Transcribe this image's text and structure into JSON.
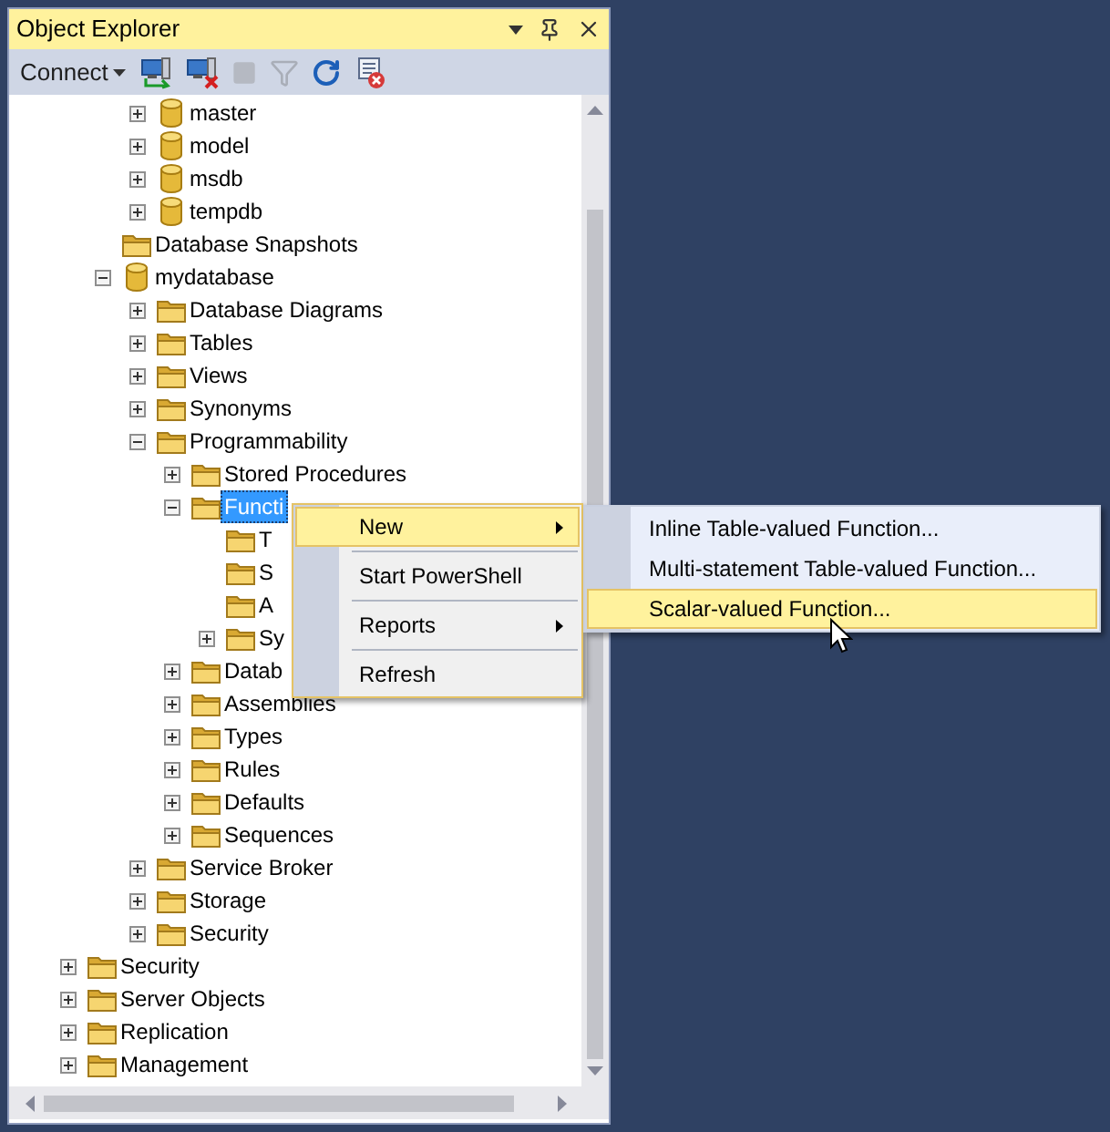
{
  "window": {
    "title": "Object Explorer"
  },
  "toolbar": [
    {
      "kind": "connect",
      "label": "Connect",
      "disabled": false
    },
    {
      "kind": "connect-server",
      "disabled": false
    },
    {
      "kind": "disconnect",
      "disabled": false
    },
    {
      "kind": "stop",
      "disabled": true
    },
    {
      "kind": "filter",
      "disabled": true
    },
    {
      "kind": "refresh",
      "disabled": false
    },
    {
      "kind": "script-error",
      "disabled": false
    }
  ],
  "tree": [
    {
      "children": [
        {
          "children": [
            {
              "children": [
                {
                  "label": "master",
                  "kind": "database",
                  "expandable": true,
                  "expanded": false,
                  "selected": false
                },
                {
                  "label": "model",
                  "kind": "database",
                  "expandable": true,
                  "expanded": false,
                  "selected": false
                },
                {
                  "label": "msdb",
                  "kind": "database",
                  "expandable": true,
                  "expanded": false,
                  "selected": false
                },
                {
                  "label": "tempdb",
                  "kind": "database",
                  "expandable": true,
                  "expanded": false,
                  "selected": false
                }
              ]
            },
            {
              "label": "Database Snapshots",
              "kind": "folder",
              "expandable": false,
              "selected": false
            },
            {
              "label": "mydatabase",
              "kind": "database",
              "expandable": true,
              "expanded": true,
              "selected": false,
              "children": [
                {
                  "label": "Database Diagrams",
                  "kind": "folder",
                  "expandable": true,
                  "expanded": false,
                  "selected": false
                },
                {
                  "label": "Tables",
                  "kind": "folder",
                  "expandable": true,
                  "expanded": false,
                  "selected": false
                },
                {
                  "label": "Views",
                  "kind": "folder",
                  "expandable": true,
                  "expanded": false,
                  "selected": false
                },
                {
                  "label": "Synonyms",
                  "kind": "folder",
                  "expandable": true,
                  "expanded": false,
                  "selected": false
                },
                {
                  "label": "Programmability",
                  "kind": "folder",
                  "expandable": true,
                  "expanded": true,
                  "selected": false,
                  "children": [
                    {
                      "label": "Stored Procedures",
                      "kind": "folder",
                      "expandable": true,
                      "expanded": false,
                      "selected": false
                    },
                    {
                      "label": "Functi",
                      "kind": "folder",
                      "expandable": true,
                      "expanded": true,
                      "selected": true,
                      "children": [
                        {
                          "label": "T",
                          "kind": "folder",
                          "expandable": false,
                          "selected": false
                        },
                        {
                          "label": "S",
                          "kind": "folder",
                          "expandable": false,
                          "selected": false
                        },
                        {
                          "label": "A",
                          "kind": "folder",
                          "expandable": false,
                          "selected": false
                        },
                        {
                          "label": "Sy",
                          "kind": "folder",
                          "expandable": true,
                          "expanded": false,
                          "selected": false
                        }
                      ]
                    },
                    {
                      "label": "Datab",
                      "kind": "folder",
                      "expandable": true,
                      "expanded": false,
                      "selected": false
                    },
                    {
                      "label": "Assemblies",
                      "kind": "folder",
                      "expandable": true,
                      "expanded": false,
                      "selected": false
                    },
                    {
                      "label": "Types",
                      "kind": "folder",
                      "expandable": true,
                      "expanded": false,
                      "selected": false
                    },
                    {
                      "label": "Rules",
                      "kind": "folder",
                      "expandable": true,
                      "expanded": false,
                      "selected": false
                    },
                    {
                      "label": "Defaults",
                      "kind": "folder",
                      "expandable": true,
                      "expanded": false,
                      "selected": false
                    },
                    {
                      "label": "Sequences",
                      "kind": "folder",
                      "expandable": true,
                      "expanded": false,
                      "selected": false
                    }
                  ]
                },
                {
                  "label": "Service Broker",
                  "kind": "folder",
                  "expandable": true,
                  "expanded": false,
                  "selected": false
                },
                {
                  "label": "Storage",
                  "kind": "folder",
                  "expandable": true,
                  "expanded": false,
                  "selected": false
                },
                {
                  "label": "Security",
                  "kind": "folder",
                  "expandable": true,
                  "expanded": false,
                  "selected": false
                }
              ]
            }
          ]
        },
        {
          "label": "Security",
          "kind": "folder",
          "expandable": true,
          "expanded": false,
          "selected": false
        },
        {
          "label": "Server Objects",
          "kind": "folder",
          "expandable": true,
          "expanded": false,
          "selected": false
        },
        {
          "label": "Replication",
          "kind": "folder",
          "expandable": true,
          "expanded": false,
          "selected": false
        },
        {
          "label": "Management",
          "kind": "folder",
          "expandable": true,
          "expanded": false,
          "selected": false
        }
      ]
    }
  ],
  "context_menu": {
    "items": [
      {
        "kind": "item",
        "label": "New",
        "submenu": true,
        "selected": true
      },
      {
        "kind": "separator"
      },
      {
        "kind": "item",
        "label": "Start PowerShell",
        "submenu": false,
        "selected": false
      },
      {
        "kind": "separator"
      },
      {
        "kind": "item",
        "label": "Reports",
        "submenu": true,
        "selected": false
      },
      {
        "kind": "separator"
      },
      {
        "kind": "item",
        "label": "Refresh",
        "submenu": false,
        "selected": false
      }
    ]
  },
  "submenu": {
    "items": [
      {
        "label": "Inline Table-valued Function...",
        "selected": false
      },
      {
        "label": "Multi-statement Table-valued Function...",
        "selected": false
      },
      {
        "label": "Scalar-valued Function...",
        "selected": true
      }
    ]
  }
}
